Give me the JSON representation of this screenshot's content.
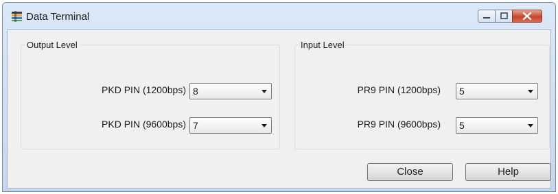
{
  "window": {
    "title": "Data Terminal"
  },
  "output_level": {
    "legend": "Output Level",
    "rows": [
      {
        "label": "PKD PIN (1200bps)",
        "value": "8"
      },
      {
        "label": "PKD PIN (9600bps)",
        "value": "7"
      }
    ]
  },
  "input_level": {
    "legend": "Input Level",
    "rows": [
      {
        "label": "PR9 PIN (1200bps)",
        "value": "5"
      },
      {
        "label": "PR9 PIN (9600bps)",
        "value": "5"
      }
    ]
  },
  "buttons": {
    "close": "Close",
    "help": "Help"
  },
  "icons": {
    "app": "data-terminal-icon",
    "minimize": "minimize-icon",
    "maximize": "maximize-icon",
    "close": "close-icon"
  }
}
